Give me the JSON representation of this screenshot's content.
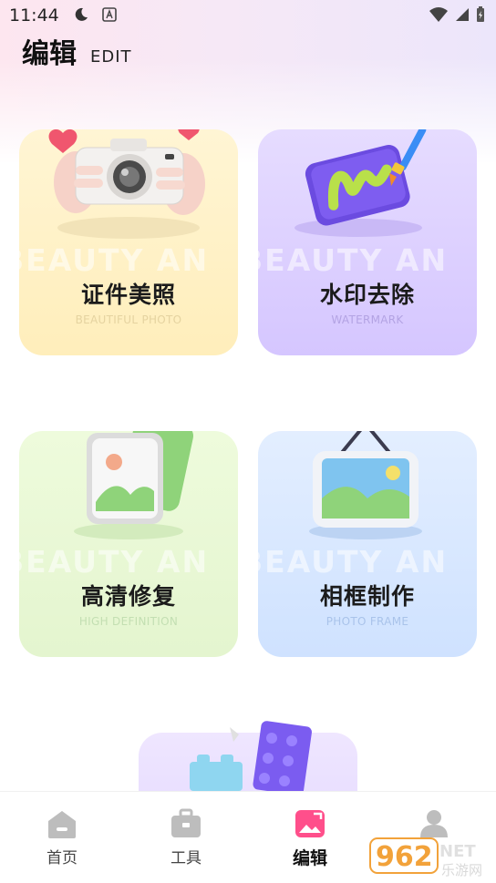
{
  "status_bar": {
    "time": "11:44",
    "icons": [
      "moon-icon",
      "font-a-icon",
      "wifi-icon",
      "signal-icon",
      "battery-icon"
    ]
  },
  "header": {
    "title": "编辑",
    "subtitle": "EDIT"
  },
  "cards": [
    {
      "title": "证件美照",
      "subtitle": "BEAUTIFUL PHOTO",
      "watermark": "BEAUTY AN",
      "icon": "camera-icon",
      "sub_color": "#e8d7a6"
    },
    {
      "title": "水印去除",
      "subtitle": "WATERMARK",
      "watermark": "BEAUTY AN",
      "icon": "paint-board-icon",
      "sub_color": "#b6a6e6"
    },
    {
      "title": "高清修复",
      "subtitle": "HIGH DEFINITION",
      "watermark": "BEAUTY AN",
      "icon": "photo-stack-icon",
      "sub_color": "#c3dfb2"
    },
    {
      "title": "相框制作",
      "subtitle": "PHOTO FRAME",
      "watermark": "BEAUTY AN",
      "icon": "hanging-frame-icon",
      "sub_color": "#a9c3ea"
    }
  ],
  "partial_card": {
    "icon": "building-blocks-icon"
  },
  "nav": [
    {
      "label": "首页",
      "icon": "home-icon",
      "active": false
    },
    {
      "label": "工具",
      "icon": "toolbox-icon",
      "active": false
    },
    {
      "label": "编辑",
      "icon": "image-edit-icon",
      "active": true
    },
    {
      "label": "",
      "icon": "user-icon",
      "active": false
    }
  ],
  "watermark_logo": {
    "text": "962",
    "suffix": "NET",
    "caption": "乐游网"
  },
  "colors": {
    "accent": "#ff4f8b",
    "yellow_card": "#ffeebb",
    "purple_card": "#d5c6ff",
    "green_card": "#e4f5cf",
    "blue_card": "#cfe2ff"
  }
}
